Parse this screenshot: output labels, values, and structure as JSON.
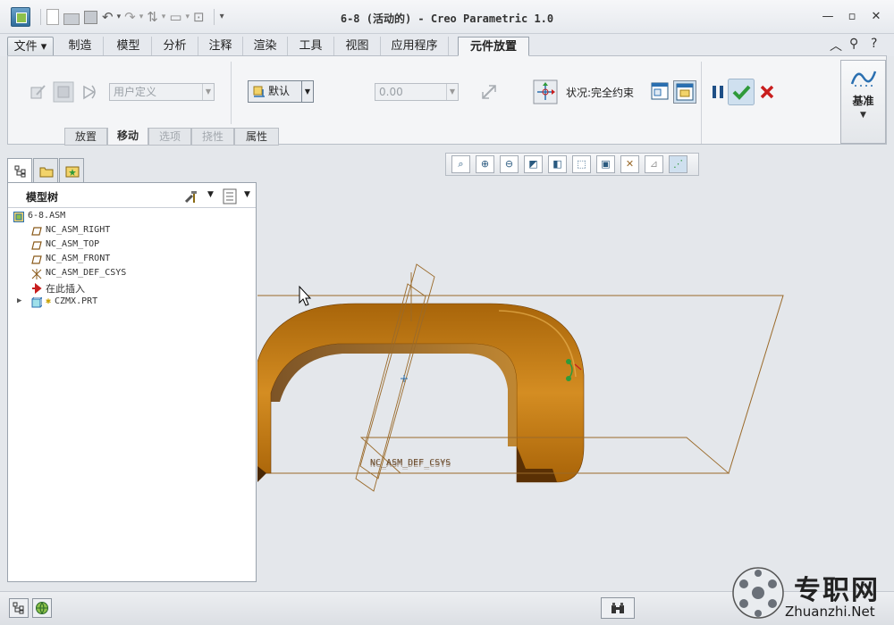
{
  "window": {
    "title": "6-8 (活动的) - Creo Parametric 1.0",
    "controls": [
      "—",
      "▫",
      "✕"
    ]
  },
  "quick_access": {
    "icons": [
      "app-icon",
      "new-icon",
      "open-icon",
      "save-icon",
      "undo-icon",
      "redo-icon",
      "regenerate-icon",
      "window-icon",
      "close-window-icon",
      "customize-icon"
    ]
  },
  "ribbon_tabs": [
    {
      "label": "文件 ▾"
    },
    {
      "label": "制造"
    },
    {
      "label": "模型"
    },
    {
      "label": "分析"
    },
    {
      "label": "注释"
    },
    {
      "label": "渲染"
    },
    {
      "label": "工具"
    },
    {
      "label": "视图"
    },
    {
      "label": "应用程序"
    },
    {
      "label": "元件放置"
    }
  ],
  "ribbon": {
    "constraint_set": "用户定义",
    "constraint_type": "默认",
    "offset_value": "0.00",
    "status_text": "状况:完全约束",
    "subtabs": [
      {
        "label": "放置",
        "disabled": false
      },
      {
        "label": "移动",
        "disabled": false,
        "active": true
      },
      {
        "label": "选项",
        "disabled": true
      },
      {
        "label": "挠性",
        "disabled": true
      },
      {
        "label": "属性",
        "disabled": false
      }
    ],
    "datum_label": "基准",
    "pause_icon": "pause-icon",
    "ok_icon": "checkmark-icon",
    "cancel_icon": "cancel-icon"
  },
  "graphics_toolbar": {
    "icons": [
      "refit-icon",
      "zoom-in-icon",
      "zoom-out-icon",
      "repaint-icon",
      "display-style-icon",
      "saved-views-icon",
      "view-manager-icon",
      "datum-display-icon",
      "spin-center-icon",
      "annotation-display-icon"
    ]
  },
  "model_tree": {
    "title": "模型树",
    "items": [
      {
        "label": "6-8.ASM",
        "icon": "assembly-icon",
        "indent": 0
      },
      {
        "label": "NC_ASM_RIGHT",
        "icon": "datum-plane-icon",
        "indent": 1
      },
      {
        "label": "NC_ASM_TOP",
        "icon": "datum-plane-icon",
        "indent": 1
      },
      {
        "label": "NC_ASM_FRONT",
        "icon": "datum-plane-icon",
        "indent": 1
      },
      {
        "label": "NC_ASM_DEF_CSYS",
        "icon": "csys-icon",
        "indent": 1
      },
      {
        "label": "在此插入",
        "icon": "insert-here-icon",
        "indent": 1
      },
      {
        "label": "CZMX.PRT",
        "icon": "part-icon",
        "indent": 1,
        "expandable": true
      }
    ]
  },
  "viewport": {
    "csys_label": "NC_ASM_DEF_CSYS",
    "model_color": "#b9740d"
  },
  "watermark": {
    "cn": "专职网",
    "en": "Zhuanzhi.Net"
  },
  "colors": {
    "accent": "#2a6fb0",
    "ok_green": "#2f9a3a",
    "cancel_red": "#c81e1e",
    "datum_line": "#9a6a2a"
  }
}
